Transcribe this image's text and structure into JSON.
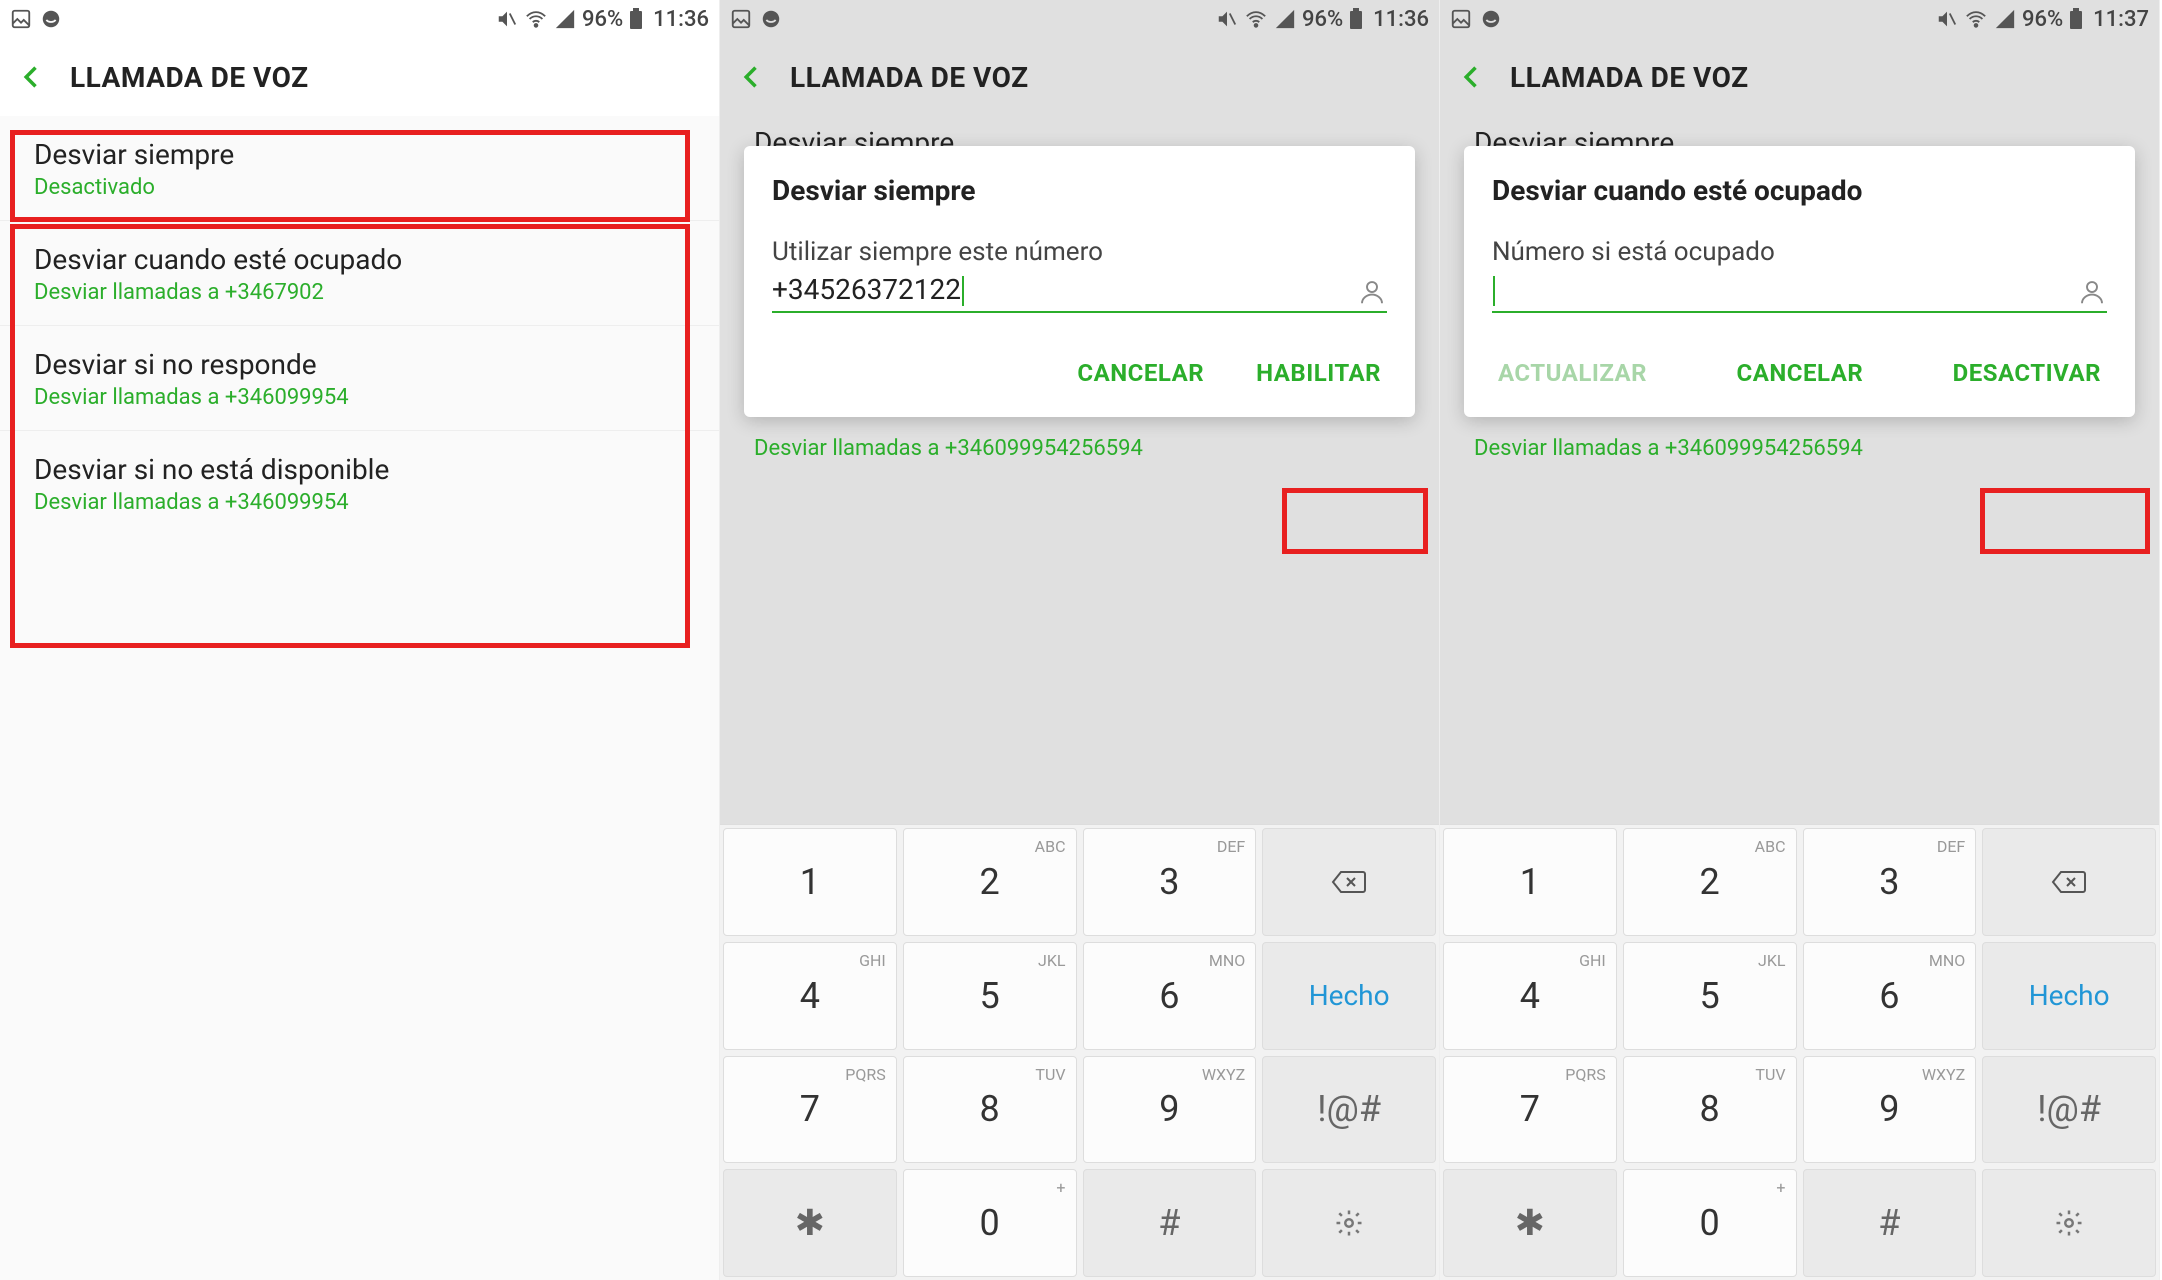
{
  "status": {
    "battery": "96%",
    "times": [
      "11:36",
      "11:36",
      "11:37"
    ]
  },
  "header": {
    "title": "LLAMADA DE VOZ"
  },
  "list": {
    "items": [
      {
        "title": "Desviar siempre",
        "sub": "Desactivado"
      },
      {
        "title": "Desviar cuando esté ocupado",
        "sub": "Desviar llamadas a +3467902"
      },
      {
        "title": "Desviar si no responde",
        "sub": "Desviar llamadas a +346099954"
      },
      {
        "title": "Desviar si no está disponible",
        "sub": "Desviar llamadas a +346099954"
      }
    ]
  },
  "screen2": {
    "bg_title": "Desviar siempre",
    "bg_sub": "Desviar llamadas a +346099954256594",
    "dialog": {
      "title": "Desviar siempre",
      "label": "Utilizar siempre este número",
      "value": "+34526372122",
      "cancel": "CANCELAR",
      "confirm": "HABILITAR"
    }
  },
  "screen3": {
    "bg_title": "Desviar siempre",
    "bg_sub": "Desviar llamadas a +346099954256594",
    "dialog": {
      "title": "Desviar cuando esté ocupado",
      "label": "Número si está ocupado",
      "value": "",
      "update": "ACTUALIZAR",
      "cancel": "CANCELAR",
      "confirm": "DESACTIVAR"
    }
  },
  "keyboard": {
    "rows": [
      [
        {
          "main": "1",
          "sub": ""
        },
        {
          "main": "2",
          "sub": "ABC"
        },
        {
          "main": "3",
          "sub": "DEF"
        },
        {
          "main": "⌫",
          "special": "backspace"
        }
      ],
      [
        {
          "main": "4",
          "sub": "GHI"
        },
        {
          "main": "5",
          "sub": "JKL"
        },
        {
          "main": "6",
          "sub": "MNO"
        },
        {
          "main": "Hecho",
          "special": "done"
        }
      ],
      [
        {
          "main": "7",
          "sub": "PQRS"
        },
        {
          "main": "8",
          "sub": "TUV"
        },
        {
          "main": "9",
          "sub": "WXYZ"
        },
        {
          "main": "!@#",
          "special": "sym"
        }
      ],
      [
        {
          "main": "✱",
          "special": "star"
        },
        {
          "main": "0",
          "sub": "+"
        },
        {
          "main": "#",
          "special": "hash"
        },
        {
          "main": "⚙",
          "special": "settings"
        }
      ]
    ]
  }
}
